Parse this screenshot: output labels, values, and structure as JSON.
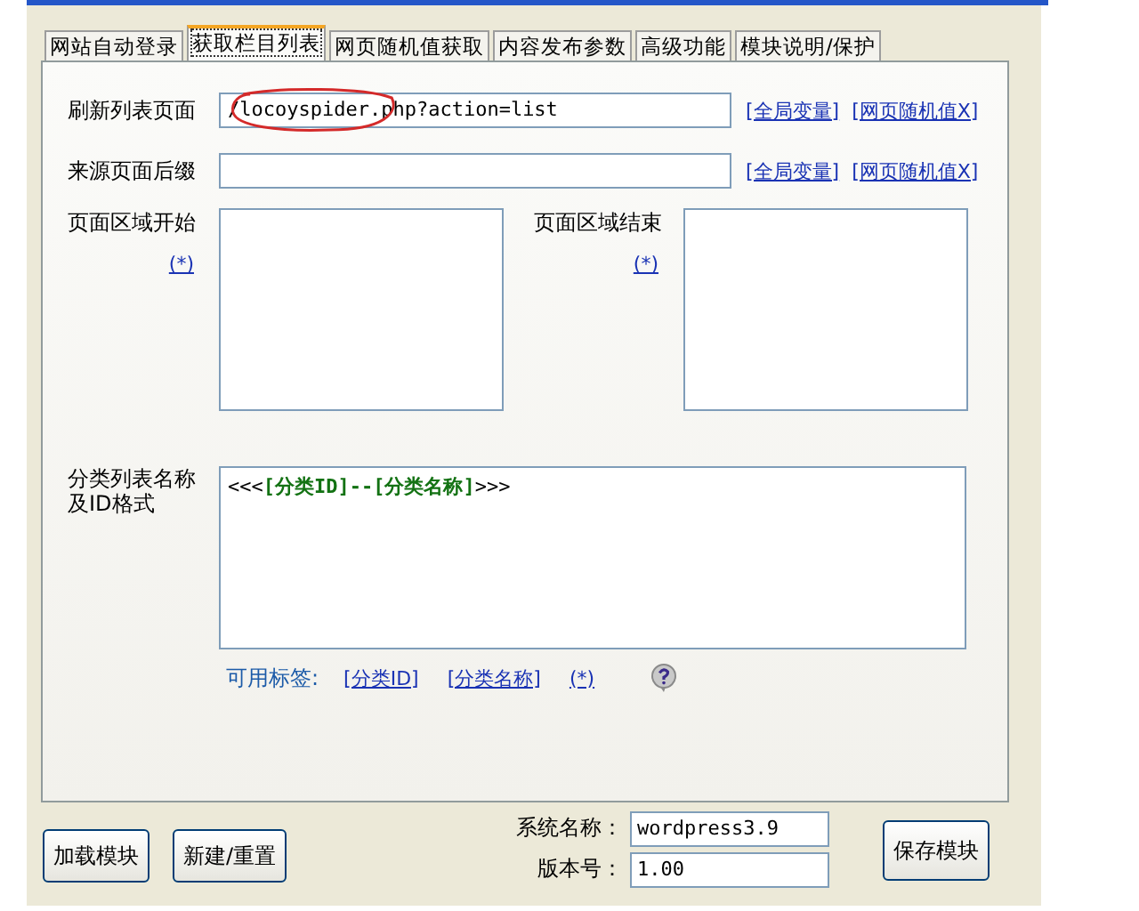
{
  "tabs": [
    {
      "label": "网站自动登录",
      "selected": false
    },
    {
      "label": "获取栏目列表",
      "selected": true
    },
    {
      "label": "网页随机值获取",
      "selected": false
    },
    {
      "label": "内容发布参数",
      "selected": false
    },
    {
      "label": "高级功能",
      "selected": false
    },
    {
      "label": "模块说明/保护",
      "selected": false
    }
  ],
  "refresh_page": {
    "label": "刷新列表页面",
    "value": "/locoyspider.php?action=list",
    "links": [
      "[全局变量]",
      "[网页随机值X]"
    ],
    "highlighted": true
  },
  "source_suffix": {
    "label": "来源页面后缀",
    "links": [
      "[全局变量]",
      "[网页随机值X]"
    ]
  },
  "area_start": {
    "label": "页面区域开始",
    "link": "(*)"
  },
  "area_end": {
    "label": "页面区域结束",
    "link": "(*)"
  },
  "category_format": {
    "label": "分类列表名称及ID格式",
    "value": "<<<**[分类ID]--[分类名称]**>>>"
  },
  "available_tags": {
    "label": "可用标签:",
    "links": [
      "[分类ID]",
      "[分类名称]",
      "(*)"
    ]
  },
  "bottom": {
    "buttons": [
      "加载模块",
      "新建/重置"
    ],
    "system_name": {
      "label": "系统名称：",
      "value": "wordpress3.9"
    },
    "version": {
      "label": "版本号：",
      "value": "1.00"
    },
    "save_button": "保存模块"
  }
}
